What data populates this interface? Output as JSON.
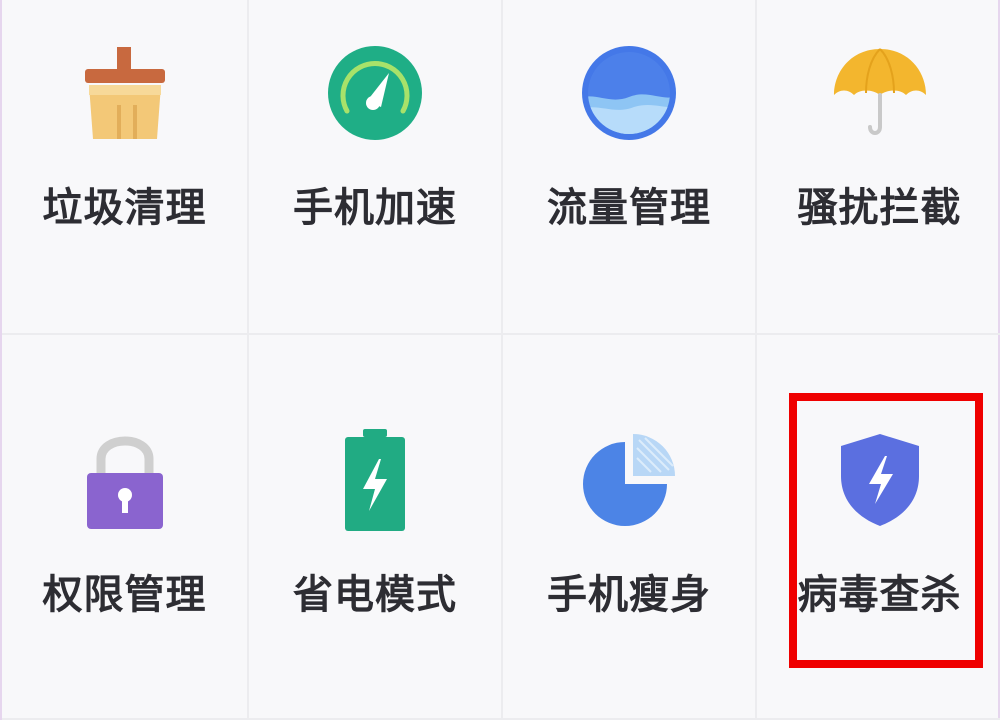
{
  "tools": [
    {
      "label": "垃圾清理",
      "icon": "broom-icon",
      "color": "#f1c36b"
    },
    {
      "label": "手机加速",
      "icon": "speedometer-icon",
      "color": "#1fae86"
    },
    {
      "label": "流量管理",
      "icon": "water-level-icon",
      "color": "#4478e8"
    },
    {
      "label": "骚扰拦截",
      "icon": "umbrella-icon",
      "color": "#f3b62e"
    },
    {
      "label": "权限管理",
      "icon": "padlock-icon",
      "color": "#8a64cf"
    },
    {
      "label": "省电模式",
      "icon": "battery-charge-icon",
      "color": "#21ab83"
    },
    {
      "label": "手机瘦身",
      "icon": "pie-chart-icon",
      "color": "#4c84e6"
    },
    {
      "label": "病毒查杀",
      "icon": "shield-lightning-icon",
      "color": "#5b6fe0"
    }
  ],
  "highlight": {
    "target": "病毒查杀",
    "color": "#ef0000"
  }
}
